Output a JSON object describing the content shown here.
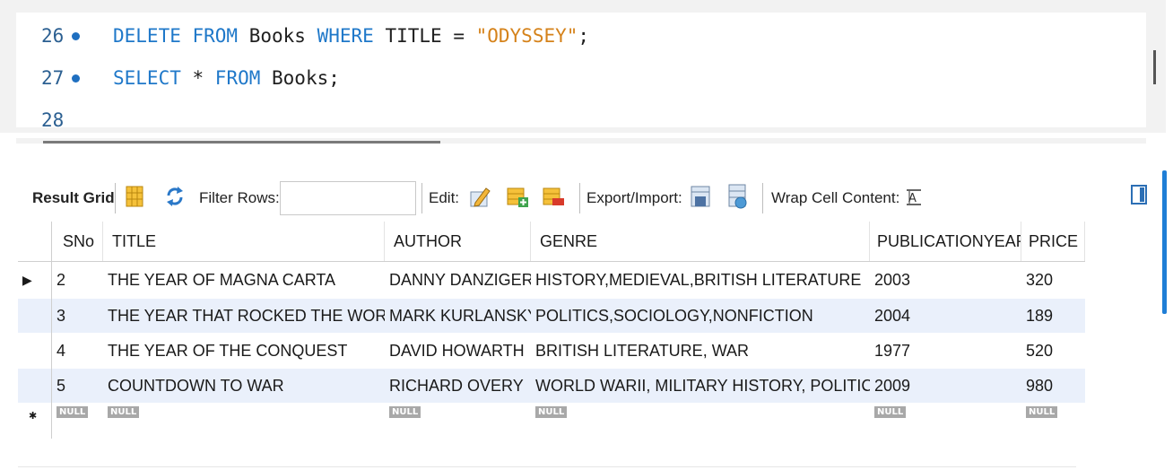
{
  "editor": {
    "lines": [
      {
        "number": "26",
        "tokens": [
          {
            "t": "kw",
            "v": "DELETE FROM"
          },
          {
            "t": "plain",
            "v": " Books "
          },
          {
            "t": "kw",
            "v": "WHERE"
          },
          {
            "t": "plain",
            "v": " TITLE = "
          },
          {
            "t": "str",
            "v": "\"ODYSSEY\""
          },
          {
            "t": "plain",
            "v": ";"
          }
        ]
      },
      {
        "number": "27",
        "tokens": [
          {
            "t": "kw",
            "v": "SELECT"
          },
          {
            "t": "plain",
            "v": " * "
          },
          {
            "t": "kw",
            "v": "FROM"
          },
          {
            "t": "plain",
            "v": " Books;"
          }
        ]
      },
      {
        "number": "28",
        "tokens": []
      }
    ]
  },
  "toolbar": {
    "result_grid_label": "Result Grid",
    "filter_rows_label": "Filter Rows:",
    "filter_value": "",
    "edit_label": "Edit:",
    "export_import_label": "Export/Import:",
    "wrap_cell_label": "Wrap Cell Content:"
  },
  "grid": {
    "columns": [
      "SNo",
      "TITLE",
      "AUTHOR",
      "GENRE",
      "PUBLICATIONYEAR",
      "PRICE"
    ],
    "rows": [
      [
        "2",
        "THE YEAR OF MAGNA CARTA",
        "DANNY DANZIGER",
        "HISTORY,MEDIEVAL,BRITISH LITERATURE",
        "2003",
        "320"
      ],
      [
        "3",
        "THE YEAR THAT ROCKED THE WORLD",
        "MARK KURLANSKY",
        "POLITICS,SOCIOLOGY,NONFICTION",
        "2004",
        "189"
      ],
      [
        "4",
        "THE YEAR OF THE CONQUEST",
        "DAVID HOWARTH",
        "BRITISH LITERATURE, WAR",
        "1977",
        "520"
      ],
      [
        "5",
        "COUNTDOWN TO WAR",
        "RICHARD OVERY",
        "WORLD WARII, MILITARY HISTORY, POLITICS",
        "2009",
        "980"
      ]
    ],
    "null_label": "NULL",
    "current_row_marker": "▶",
    "new_row_marker": "✱"
  },
  "colors": {
    "keyword": "#1f78c9",
    "string": "#d5821a",
    "row_alt": "#eaf0fb",
    "accent": "#1f7ed6"
  }
}
